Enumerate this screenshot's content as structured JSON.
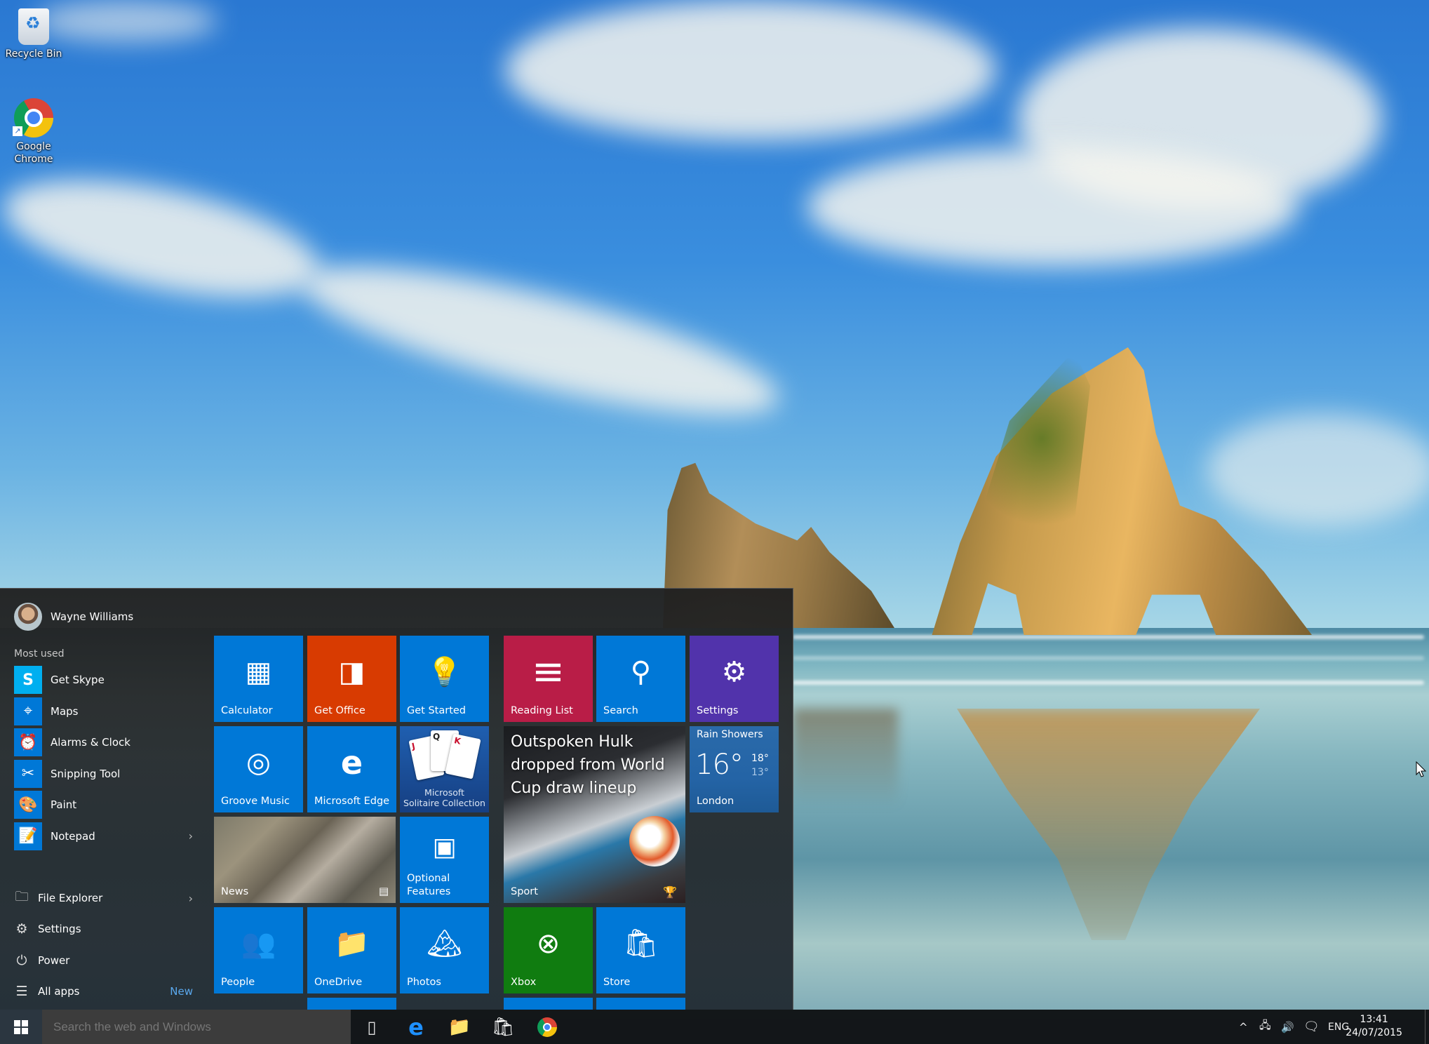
{
  "desktop": {
    "icons": [
      {
        "label": "Recycle Bin",
        "icon": "recycle-bin-icon"
      },
      {
        "label": "Google Chrome",
        "icon": "chrome-icon"
      }
    ]
  },
  "start_menu": {
    "user_name": "Wayne Williams",
    "most_used_label": "Most used",
    "most_used": [
      {
        "label": "Get Skype",
        "icon": "skype-icon",
        "glyph": "S"
      },
      {
        "label": "Maps",
        "icon": "maps-icon",
        "glyph": "⌖"
      },
      {
        "label": "Alarms & Clock",
        "icon": "alarm-clock-icon",
        "glyph": "⏰"
      },
      {
        "label": "Snipping Tool",
        "icon": "scissors-icon",
        "glyph": "✂"
      },
      {
        "label": "Paint",
        "icon": "paint-palette-icon",
        "glyph": "🎨"
      },
      {
        "label": "Notepad",
        "icon": "notepad-icon",
        "glyph": "📝",
        "has_submenu": true,
        "chevron": "›"
      }
    ],
    "system": [
      {
        "label": "File Explorer",
        "icon": "folder-icon",
        "glyph": "🗀",
        "chevron": "›"
      },
      {
        "label": "Settings",
        "icon": "gear-icon",
        "glyph": "⚙"
      },
      {
        "label": "Power",
        "icon": "power-icon",
        "glyph": "⏻"
      },
      {
        "label": "All apps",
        "icon": "list-icon",
        "glyph": "☰",
        "badge": "New"
      }
    ],
    "tiles": {
      "calculator": {
        "label": "Calculator",
        "glyph": "▦"
      },
      "get_office": {
        "label": "Get Office",
        "glyph": "◨"
      },
      "get_started": {
        "label": "Get Started",
        "glyph": "💡"
      },
      "groove": {
        "label": "Groove Music",
        "glyph": "◎"
      },
      "edge": {
        "label": "Microsoft Edge",
        "glyph": "e"
      },
      "solitaire": {
        "label_line1": "Microsoft",
        "label_line2": "Solitaire Collection",
        "cards": [
          "J",
          "Q",
          "K"
        ]
      },
      "news": {
        "label": "News",
        "glyph": "▤"
      },
      "optional_features": {
        "label_line1": "Optional",
        "label_line2": "Features",
        "glyph": "▣"
      },
      "people": {
        "label": "People",
        "glyph": "👥"
      },
      "onedrive": {
        "label": "OneDrive",
        "glyph": "📁"
      },
      "photos": {
        "label": "Photos",
        "glyph": "🏔"
      },
      "reading_list": {
        "label": "Reading List",
        "glyph": "≡"
      },
      "search": {
        "label": "Search",
        "glyph": "⚲"
      },
      "settings": {
        "label": "Settings",
        "glyph": "⚙"
      },
      "sport": {
        "headline": "Outspoken Hulk dropped from World Cup draw lineup",
        "label": "Sport",
        "glyph": "🏆"
      },
      "weather": {
        "condition": "Rain Showers",
        "temp": "16°",
        "high": "18°",
        "low": "13°",
        "city": "London"
      },
      "xbox": {
        "label": "Xbox",
        "glyph": "⊗"
      },
      "store": {
        "label": "Store",
        "glyph": "🛍"
      }
    }
  },
  "taskbar": {
    "search_placeholder": "Search the web and Windows",
    "pinned": [
      {
        "name": "task-view",
        "glyph": "▯"
      },
      {
        "name": "edge",
        "glyph": "e"
      },
      {
        "name": "file-explorer",
        "glyph": "📁"
      },
      {
        "name": "store",
        "glyph": "🛍"
      },
      {
        "name": "chrome",
        "glyph": "◉"
      }
    ],
    "tray": {
      "chevron": "^",
      "network": "🖧",
      "volume": "🔊",
      "action_center": "🗨",
      "language": "ENG",
      "time": "13:41",
      "date": "24/07/2015"
    }
  },
  "colors": {
    "tile_blue": "#0078d7",
    "office_orange": "#d83b01",
    "reading_red": "#b91d47",
    "settings_purple": "#5133ab",
    "xbox_green": "#107c10",
    "accent_link": "#5aa9ee"
  }
}
